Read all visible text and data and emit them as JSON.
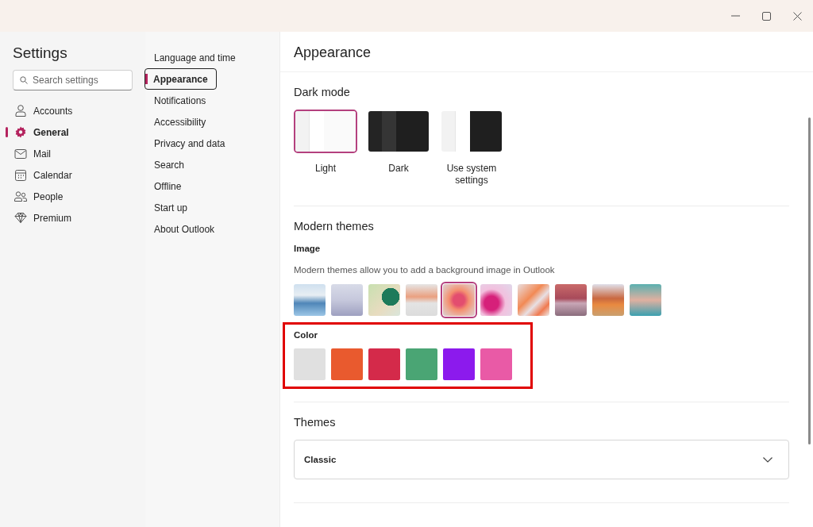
{
  "sidebar": {
    "title": "Settings",
    "search": {
      "placeholder": "Search settings"
    },
    "items": [
      {
        "label": "Accounts",
        "selected": false
      },
      {
        "label": "General",
        "selected": true
      },
      {
        "label": "Mail",
        "selected": false
      },
      {
        "label": "Calendar",
        "selected": false
      },
      {
        "label": "People",
        "selected": false
      },
      {
        "label": "Premium",
        "selected": false
      }
    ]
  },
  "subnav": {
    "items": [
      {
        "label": "Language and time",
        "selected": false
      },
      {
        "label": "Appearance",
        "selected": true
      },
      {
        "label": "Notifications",
        "selected": false
      },
      {
        "label": "Accessibility",
        "selected": false
      },
      {
        "label": "Privacy and data",
        "selected": false
      },
      {
        "label": "Search",
        "selected": false
      },
      {
        "label": "Offline",
        "selected": false
      },
      {
        "label": "Start up",
        "selected": false
      },
      {
        "label": "About Outlook",
        "selected": false
      }
    ]
  },
  "page": {
    "title": "Appearance",
    "dark_mode": {
      "heading": "Dark mode",
      "options": [
        {
          "kind": "light",
          "label": "Light",
          "selected": true
        },
        {
          "kind": "dark",
          "label": "Dark",
          "selected": false
        },
        {
          "kind": "system",
          "label": "Use system settings",
          "selected": false
        }
      ]
    },
    "modern_themes": {
      "heading": "Modern themes",
      "image_label": "Image",
      "description": "Modern themes allow you to add a background image in Outlook",
      "images": [
        {
          "selected": false
        },
        {
          "selected": false
        },
        {
          "selected": false
        },
        {
          "selected": false
        },
        {
          "selected": true
        },
        {
          "selected": false
        },
        {
          "selected": false
        },
        {
          "selected": false
        },
        {
          "selected": false
        },
        {
          "selected": false
        }
      ],
      "color_label": "Color",
      "colors": [
        {
          "color": "#e0e0e0"
        },
        {
          "color": "#e95a2e"
        },
        {
          "color": "#d42a4a"
        },
        {
          "color": "#4aa574"
        },
        {
          "color": "#8c1aed"
        },
        {
          "color": "#e95aa6"
        }
      ]
    },
    "themes": {
      "heading": "Themes",
      "value": "Classic"
    }
  }
}
